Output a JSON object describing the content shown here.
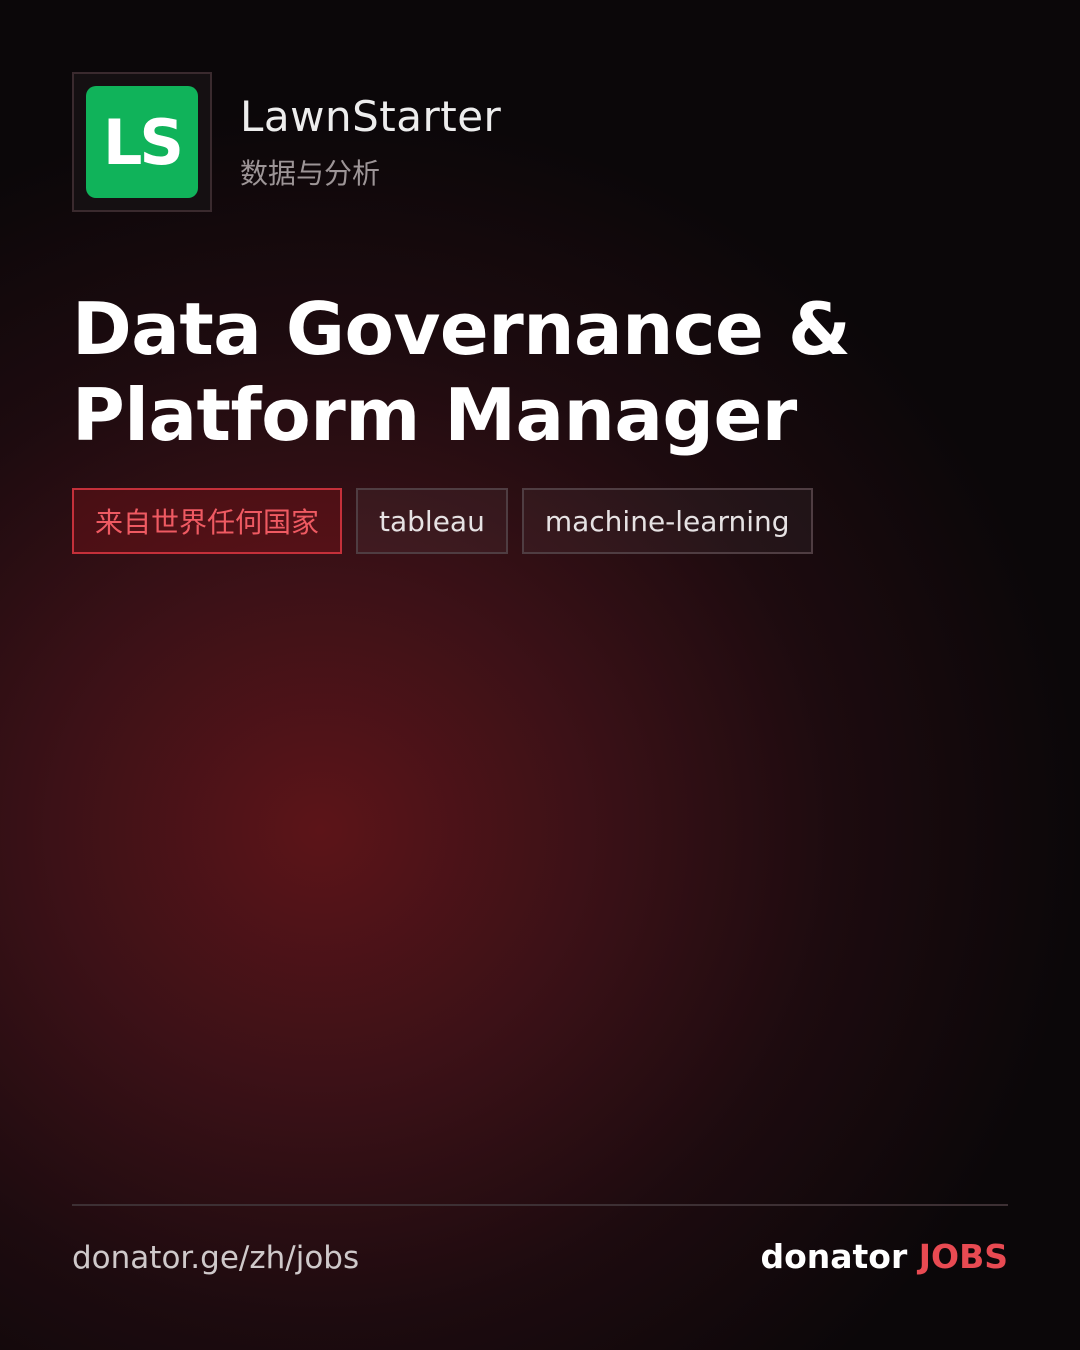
{
  "company": {
    "logo_text": "LS",
    "name": "LawnStarter",
    "category": "数据与分析"
  },
  "job": {
    "title": "Data Governance & Platform Manager"
  },
  "tags": [
    {
      "label": "来自世界任何国家"
    },
    {
      "label": "tableau"
    },
    {
      "label": "machine-learning"
    }
  ],
  "footer": {
    "url": "donator.ge/zh/jobs",
    "brand_main": "donator",
    "brand_accent": "JOBS"
  },
  "colors": {
    "logo_bg": "#10b35a",
    "accent_red": "#e84a52",
    "location_tag_border": "#c4303a"
  }
}
